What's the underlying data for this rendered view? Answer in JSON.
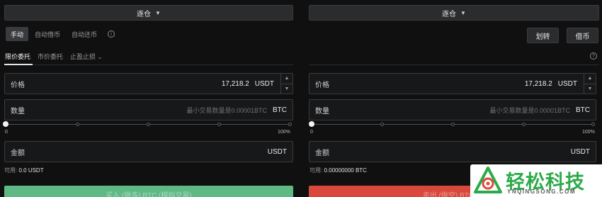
{
  "left": {
    "mode": "逐仓",
    "tabs": [
      "手动",
      "自动借币",
      "自动还币"
    ],
    "active_tab": 0,
    "order_types": [
      "限价委托",
      "市价委托",
      "止盈止损"
    ],
    "price": {
      "label": "价格",
      "value": "17,218.2",
      "unit": "USDT"
    },
    "quantity": {
      "label": "数量",
      "placeholder": "最小交易数量是0.00001BTC",
      "unit": "BTC"
    },
    "slider": {
      "min_label": "0",
      "max_label": "100%",
      "level_percent": 0
    },
    "amount": {
      "label": "金额",
      "unit": "USDT"
    },
    "available": {
      "label": "可用:",
      "value": "0.0 USDT"
    },
    "action_label": "买入 (做多) BTC (模拟交易)",
    "action_color": "#5fb985"
  },
  "right": {
    "mode": "逐仓",
    "buttons": [
      "划转",
      "借币"
    ],
    "price": {
      "label": "价格",
      "value": "17,218.2",
      "unit": "USDT"
    },
    "quantity": {
      "label": "数量",
      "placeholder": "最小交易数量是0.00001BTC",
      "unit": "BTC"
    },
    "slider": {
      "min_label": "0",
      "max_label": "100%",
      "level_percent": 0
    },
    "amount": {
      "label": "金额",
      "unit": "USDT"
    },
    "available": {
      "label": "可用:",
      "value": "0.00000000 BTC"
    },
    "action_label": "卖出 (做空) BTC (模",
    "action_color": "#d9483b"
  },
  "watermark": {
    "name": "轻松科技",
    "url": "YNQINGSONG.COM"
  }
}
